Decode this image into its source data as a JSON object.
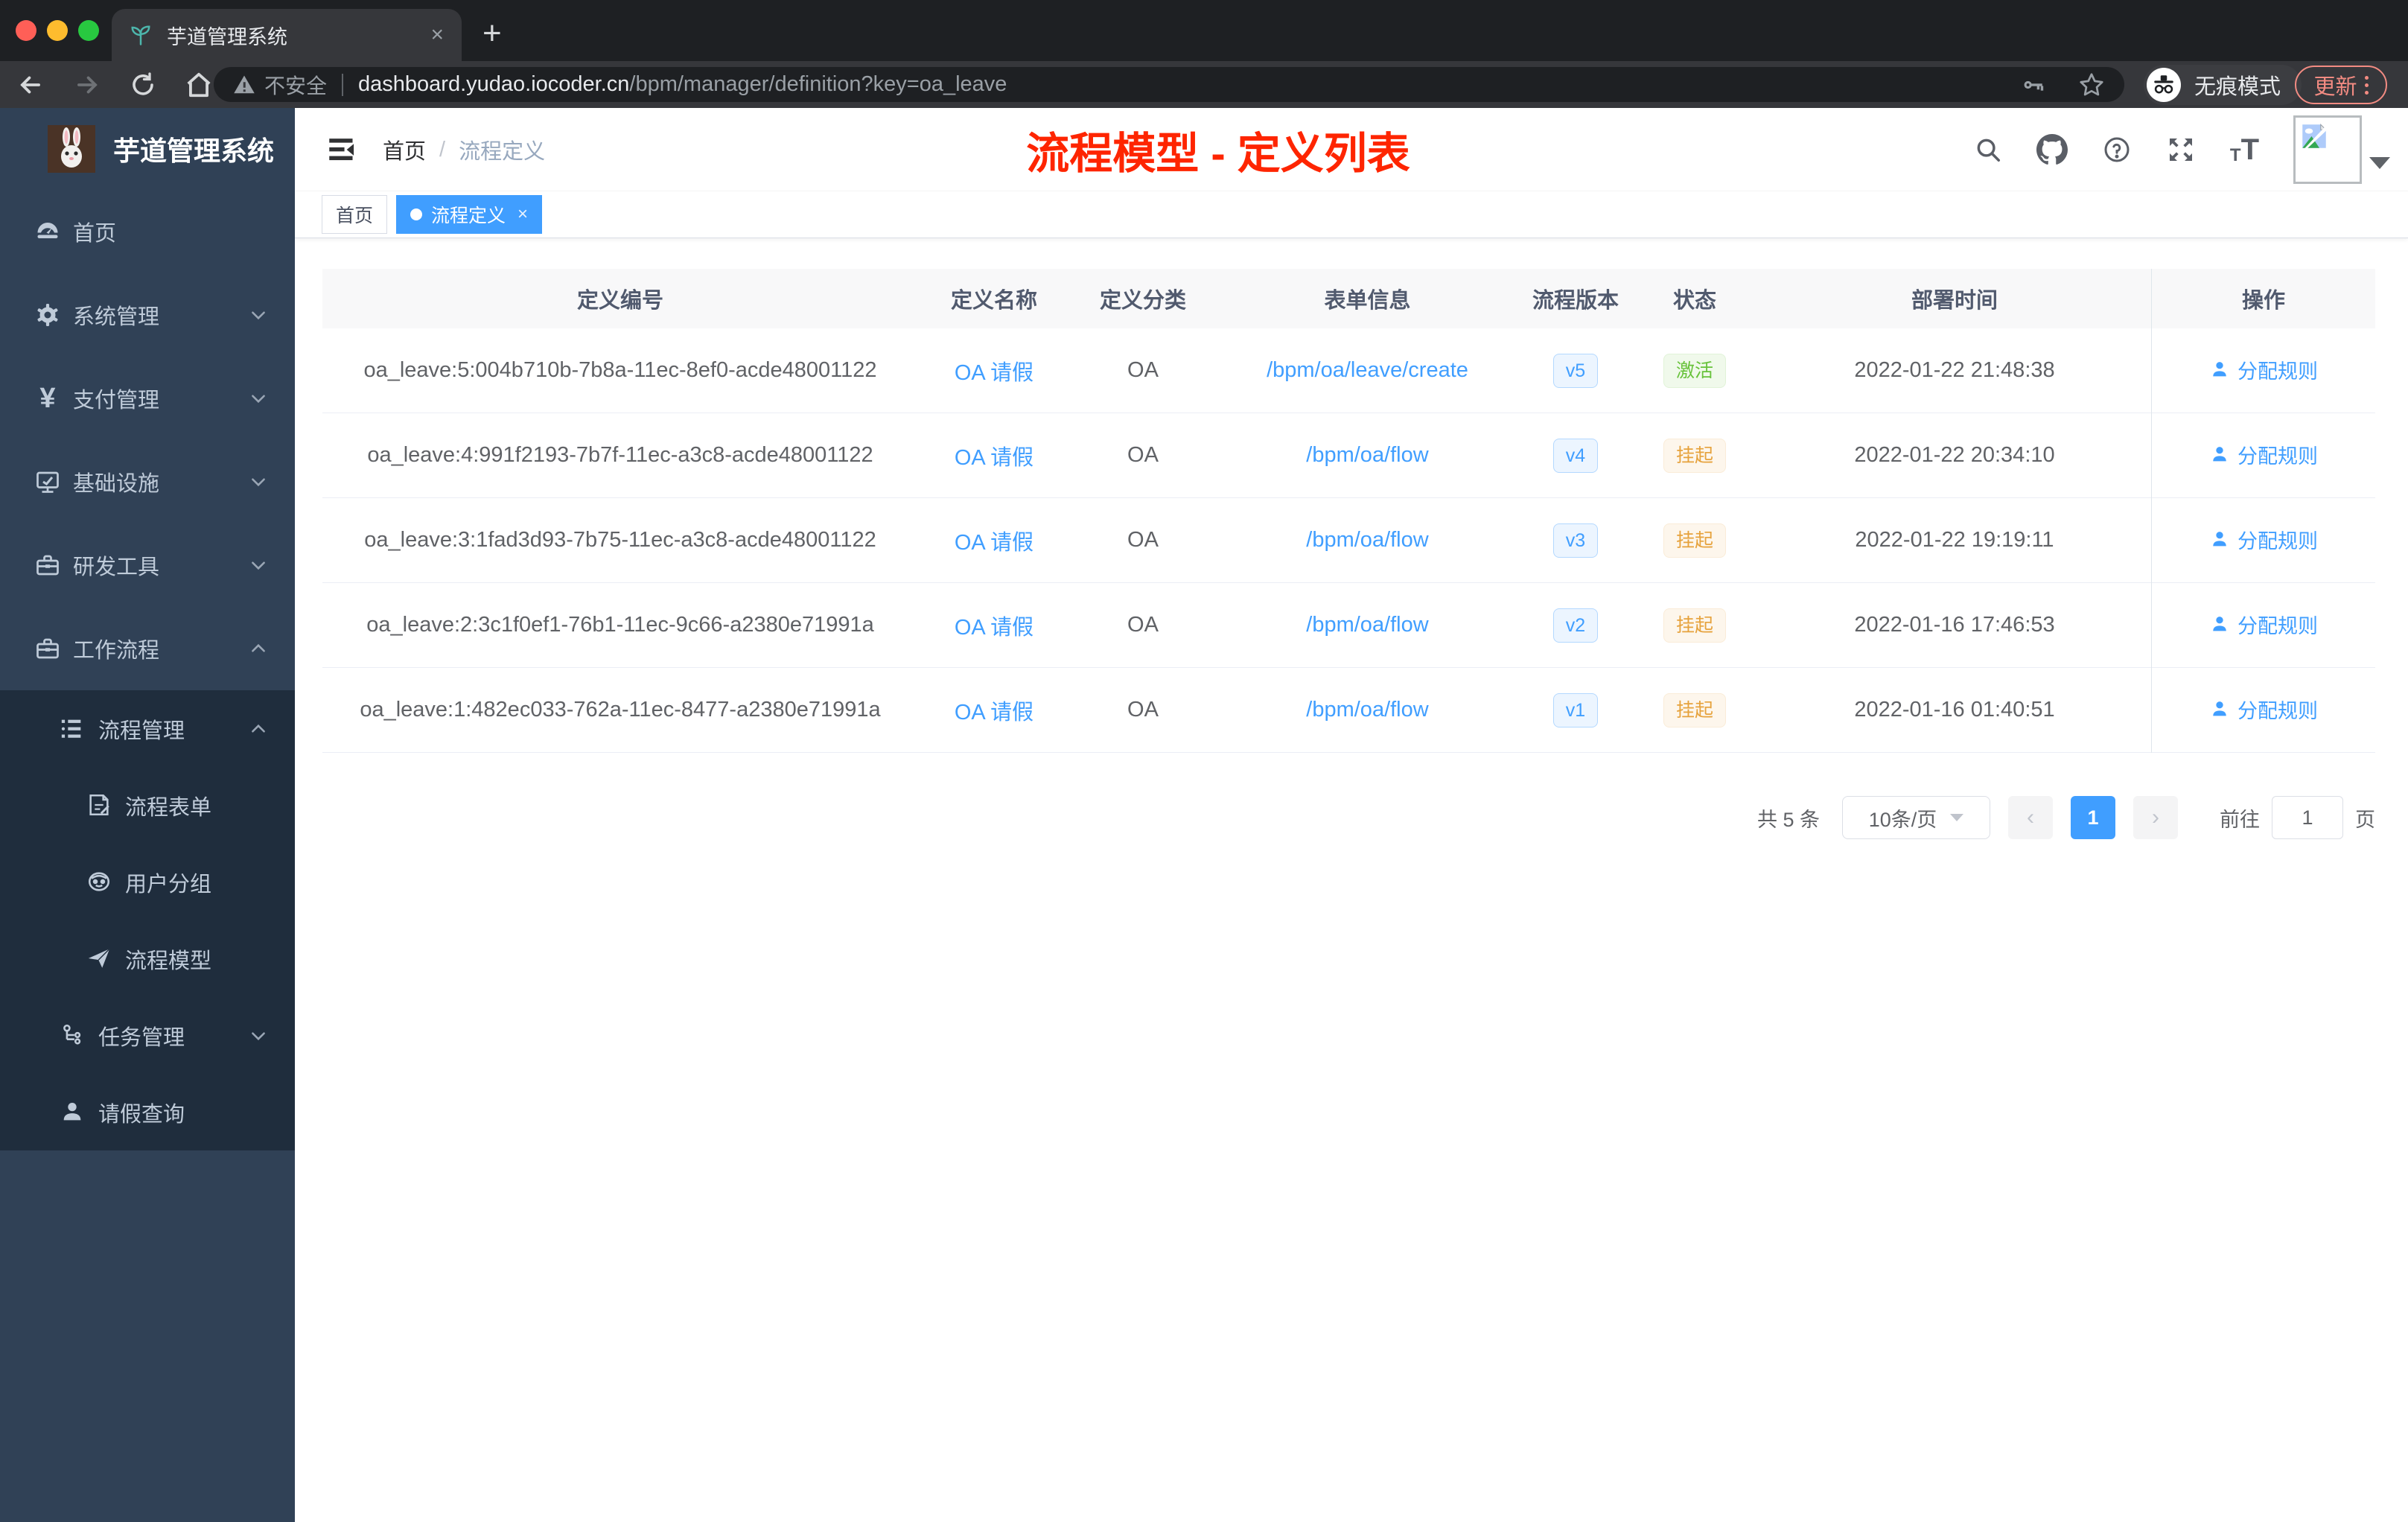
{
  "colors": {
    "accent": "#409eff",
    "annotation": "#fe2500",
    "sidebar_bg": "#304156",
    "sidebar_sub_bg": "#1f2d3d",
    "sidebar_text": "#bfcbd9",
    "version_bg": "#ecf5ff",
    "version_border": "#b3d8ff",
    "status_active_text": "#67c23a",
    "status_active_bg": "#f0f9eb",
    "status_active_border": "#e1f3d8",
    "status_suspend_text": "#e6a23c",
    "status_suspend_bg": "#fdf6ec",
    "status_suspend_border": "#faecd8"
  },
  "browser": {
    "tab_title": "芋道管理系统",
    "close_tab": "×",
    "new_tab": "+",
    "security_label": "不安全",
    "url_host": "dashboard.yudao.iocoder.cn",
    "url_path": "/bpm/manager/definition?key=oa_leave",
    "incognito_label": "无痕模式",
    "update_label": "更新"
  },
  "sidebar": {
    "app_title": "芋道管理系统",
    "items": [
      {
        "label": "首页"
      },
      {
        "label": "系统管理"
      },
      {
        "label": "支付管理"
      },
      {
        "label": "基础设施"
      },
      {
        "label": "研发工具"
      },
      {
        "label": "工作流程"
      },
      {
        "label": "流程管理"
      },
      {
        "label": "流程表单"
      },
      {
        "label": "用户分组"
      },
      {
        "label": "流程模型"
      },
      {
        "label": "任务管理"
      },
      {
        "label": "请假查询"
      }
    ],
    "yen_glyph": "¥"
  },
  "header": {
    "breadcrumb": [
      "首页",
      "流程定义"
    ],
    "breadcrumb_separator": "/",
    "annotation": "流程模型 - 定义列表"
  },
  "tags": {
    "home": "首页",
    "active": "流程定义",
    "close": "×"
  },
  "table": {
    "columns": [
      "定义编号",
      "定义名称",
      "定义分类",
      "表单信息",
      "流程版本",
      "状态",
      "部署时间",
      "操作"
    ],
    "action_label": "分配规则",
    "rows": [
      {
        "id": "oa_leave:5:004b710b-7b8a-11ec-8ef0-acde48001122",
        "name": "OA 请假",
        "category": "OA",
        "form": "/bpm/oa/leave/create",
        "version": "v5",
        "status": "激活",
        "status_type": "success",
        "time": "2022-01-22 21:48:38"
      },
      {
        "id": "oa_leave:4:991f2193-7b7f-11ec-a3c8-acde48001122",
        "name": "OA 请假",
        "category": "OA",
        "form": "/bpm/oa/flow",
        "version": "v4",
        "status": "挂起",
        "status_type": "warning",
        "time": "2022-01-22 20:34:10"
      },
      {
        "id": "oa_leave:3:1fad3d93-7b75-11ec-a3c8-acde48001122",
        "name": "OA 请假",
        "category": "OA",
        "form": "/bpm/oa/flow",
        "version": "v3",
        "status": "挂起",
        "status_type": "warning",
        "time": "2022-01-22 19:19:11"
      },
      {
        "id": "oa_leave:2:3c1f0ef1-76b1-11ec-9c66-a2380e71991a",
        "name": "OA 请假",
        "category": "OA",
        "form": "/bpm/oa/flow",
        "version": "v2",
        "status": "挂起",
        "status_type": "warning",
        "time": "2022-01-16 17:46:53"
      },
      {
        "id": "oa_leave:1:482ec033-762a-11ec-8477-a2380e71991a",
        "name": "OA 请假",
        "category": "OA",
        "form": "/bpm/oa/flow",
        "version": "v1",
        "status": "挂起",
        "status_type": "warning",
        "time": "2022-01-16 01:40:51"
      }
    ]
  },
  "pagination": {
    "total": "共 5 条",
    "page_size": "10条/页",
    "prev": "‹",
    "page": "1",
    "next": "›",
    "goto_label": "前往",
    "goto_value": "1",
    "page_unit": "页"
  }
}
